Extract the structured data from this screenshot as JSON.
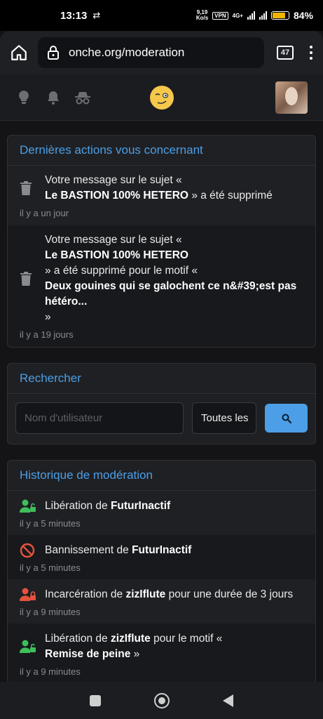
{
  "status_bar": {
    "time": "13:13",
    "net_speed_value": "9,19",
    "net_speed_unit": "Ko/s",
    "vpn": "VPN",
    "network": "4G+",
    "battery": "84%",
    "battery_level": 0.84
  },
  "browser": {
    "url": "onche.org/moderation",
    "tab_count": "47"
  },
  "notifications_card": {
    "title": "Dernières actions vous concernant",
    "items": [
      {
        "prefix": "Votre message sur le sujet «",
        "subject": "Le BASTION 100% HETERO",
        "suffix": "» a été supprimé",
        "time": "il y a un jour"
      },
      {
        "prefix": "Votre message sur le sujet «",
        "subject": "Le BASTION 100% HETERO",
        "middle": "» a été supprimé pour le motif «",
        "reason": "Deux gouines qui se galochent ce n&#39;est pas hétéro...",
        "end": "»",
        "time": "il y a 19 jours"
      }
    ]
  },
  "search_card": {
    "title": "Rechercher",
    "input_placeholder": "Nom d'utilisateur",
    "select_value": "Toutes les"
  },
  "history_card": {
    "title": "Historique de modération",
    "items": [
      {
        "type": "liberation",
        "prefix": "Libération de",
        "user": "FuturInactif",
        "suffix": "",
        "time": "il y a 5 minutes"
      },
      {
        "type": "ban",
        "prefix": "Bannissement de",
        "user": "FuturInactif",
        "suffix": "",
        "time": "il y a 5 minutes"
      },
      {
        "type": "incarceration",
        "prefix": "Incarcération de",
        "user": "zizIflute",
        "suffix": "pour une durée de 3 jours",
        "time": "il y a 9 minutes"
      },
      {
        "type": "liberation",
        "prefix": "Libération de",
        "user": "zizIflute",
        "suffix": "pour le motif «",
        "reason": "Remise de peine",
        "end": "»",
        "time": "il y a 9 minutes"
      }
    ]
  },
  "colors": {
    "accent": "#4c9fe6",
    "green": "#3fbf5a",
    "red": "#e5533d"
  }
}
